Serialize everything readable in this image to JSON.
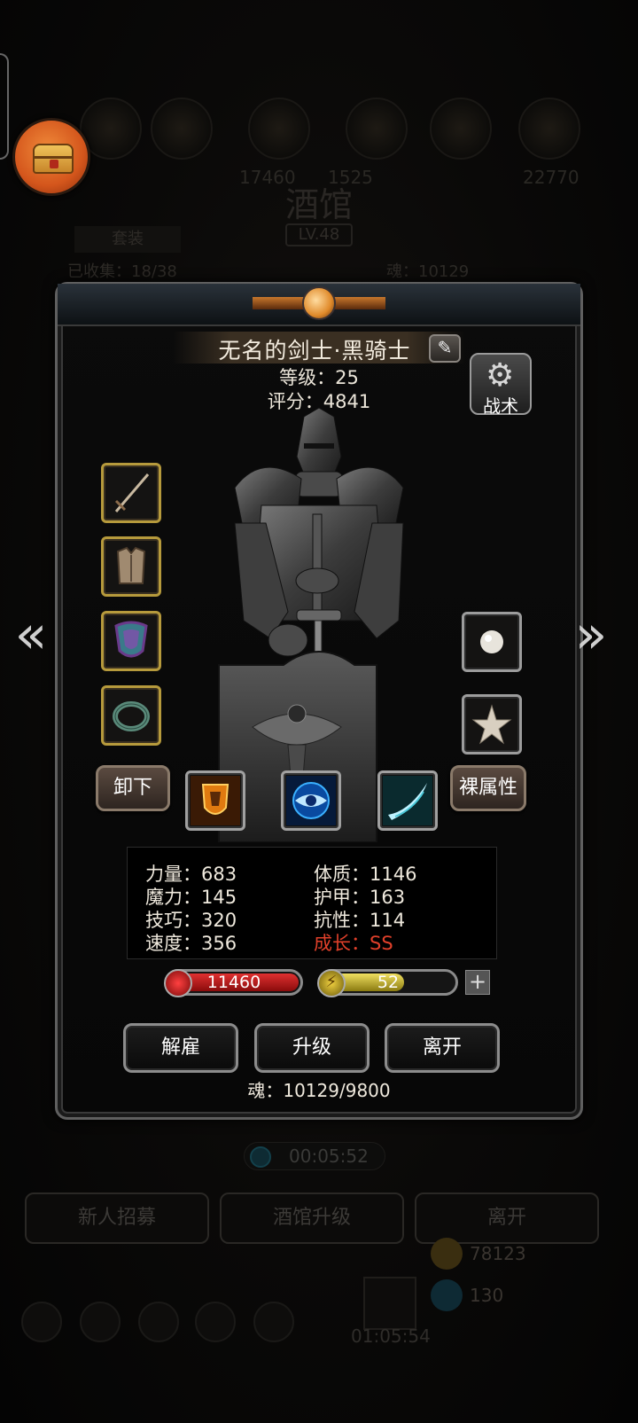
{
  "background": {
    "tavern_title": "酒馆",
    "tavern_level": "LV.48",
    "tab_label": "套装",
    "top_numbers": [
      "17460",
      "1525",
      "22770"
    ],
    "row_left": "已收集：18/38",
    "row_right": "魂：10129",
    "timer": "00:05:52",
    "buttons": [
      "新人招募",
      "酒馆升级",
      "离开"
    ],
    "gift_timer": "01:05:54",
    "gold": "78123",
    "gems": "130"
  },
  "hero": {
    "name": "无名的剑士·黑骑士",
    "level_text": "等级：25",
    "score_text": "评分：4841"
  },
  "tactics_button": {
    "label": "战术"
  },
  "equipment": {
    "left_slots": [
      "sword",
      "chest-armor",
      "shield",
      "ring"
    ],
    "right_slots": [
      "pearl",
      "starfish"
    ]
  },
  "actions": {
    "unequip": "卸下",
    "base_attributes": "裸属性"
  },
  "skills": [
    "fire-shield",
    "blue-eye",
    "ice-slash"
  ],
  "stats": {
    "strength": "力量：683",
    "magic": "魔力：145",
    "skill": "技巧：320",
    "speed": "速度：356",
    "constitution": "体质：1146",
    "armor": "护甲：163",
    "resistance": "抗性：114",
    "growth_label": "成长：",
    "growth_value": "SS"
  },
  "bars": {
    "hp": "11460",
    "energy": "52",
    "energy_fill": 0.62
  },
  "buttons": {
    "dismiss": "解雇",
    "upgrade": "升级",
    "leave": "离开"
  },
  "soul_text": "魂：10129/9800",
  "colors": {
    "gold_frame": "#b69a3c",
    "hp_red": "#c81e1e",
    "energy_yellow": "#d8c23a",
    "growth_red": "#e0402a"
  }
}
